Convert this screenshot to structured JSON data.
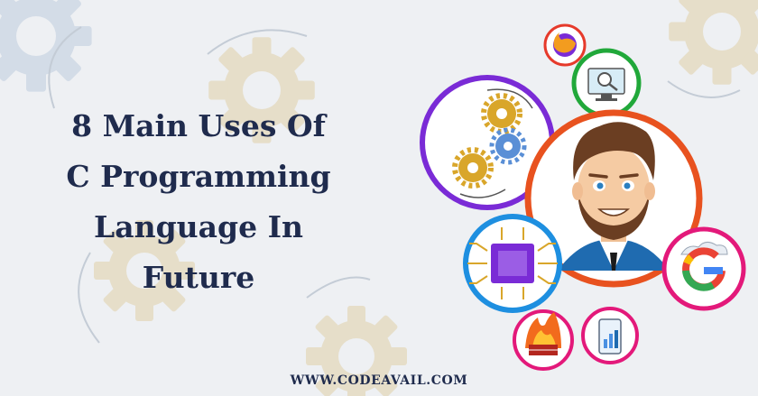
{
  "title": {
    "lines": [
      "8 Main Uses Of",
      "C Programming",
      "Language In",
      "Future"
    ]
  },
  "footer": {
    "url": "WWW.CODEAVAIL.COM"
  },
  "icons": [
    "gears-icon",
    "firefox-icon",
    "magnifier-monitor-icon",
    "cartoon-avatar",
    "cpu-chip-icon",
    "google-icon",
    "firewall-icon",
    "mobile-chart-icon"
  ],
  "colors": {
    "background": "#eef0f3",
    "title": "#1f2b4d",
    "ring_purple": "#7a2bd6",
    "ring_orange": "#e8521f",
    "ring_green": "#21a83a",
    "ring_blue": "#1e8fe0",
    "ring_pink": "#e3197a",
    "bg_gear_tan": "#e2d8bf",
    "bg_gear_blue": "#cdd9e6"
  }
}
